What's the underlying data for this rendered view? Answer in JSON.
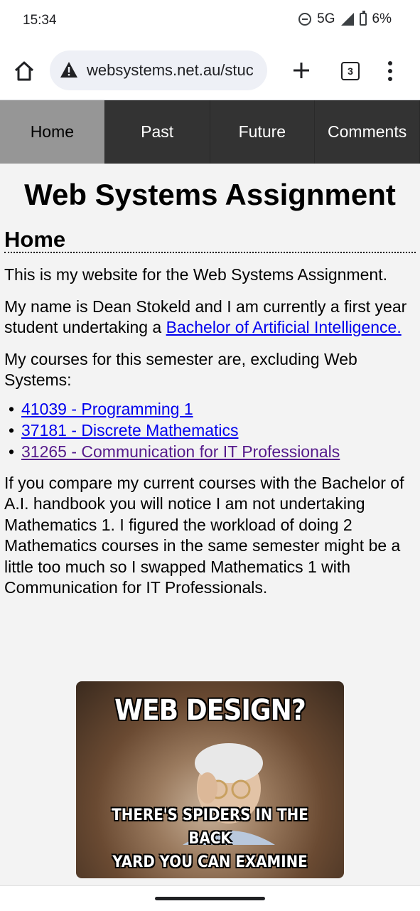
{
  "status_bar": {
    "time": "15:34",
    "network": "5G",
    "battery": "6%"
  },
  "browser": {
    "url": "websystems.net.au/stuc",
    "tab_count": "3",
    "icons": {
      "home": "home-icon",
      "security": "not-secure-warning-icon",
      "new_tab": "plus-icon",
      "tabs": "tab-switcher-icon",
      "menu": "more-vert-icon"
    }
  },
  "nav": {
    "items": [
      {
        "label": "Home",
        "active": true
      },
      {
        "label": "Past",
        "active": false
      },
      {
        "label": "Future",
        "active": false
      },
      {
        "label": "Comments",
        "active": false
      }
    ]
  },
  "page": {
    "title": "Web Systems Assignment",
    "section_heading": "Home",
    "intro": "This is my website for the Web Systems Assignment.",
    "about_prefix": "My name is Dean Stokeld and I am currently a first year student undertaking a ",
    "about_link": "Bachelor of Artificial Intelligence.",
    "courses_intro": "My courses for this semester are, excluding Web Systems:",
    "courses": [
      {
        "label": "41039 - Programming 1",
        "visited": false
      },
      {
        "label": "37181 - Discrete Mathematics",
        "visited": false
      },
      {
        "label": "31265 - Communication for IT Professionals",
        "visited": true
      }
    ],
    "explanation": "If you compare my current courses with the Bachelor of A.I. handbook you will notice I am not undertaking Mathematics 1. I figured the workload of doing 2 Mathematics courses in the same semester might be a little too much so I swapped Mathematics 1 with Communication for IT Professionals."
  },
  "meme": {
    "top_text": "WEB DESIGN?",
    "bottom_line1": "THERE'S SPIDERS IN THE BACK",
    "bottom_line2": "YARD YOU CAN EXAMINE"
  },
  "colors": {
    "nav_bg": "#333333",
    "nav_active": "#969696",
    "link": "#0000ee",
    "visited_link": "#551a8b",
    "page_bg": "#f3f3f3"
  }
}
